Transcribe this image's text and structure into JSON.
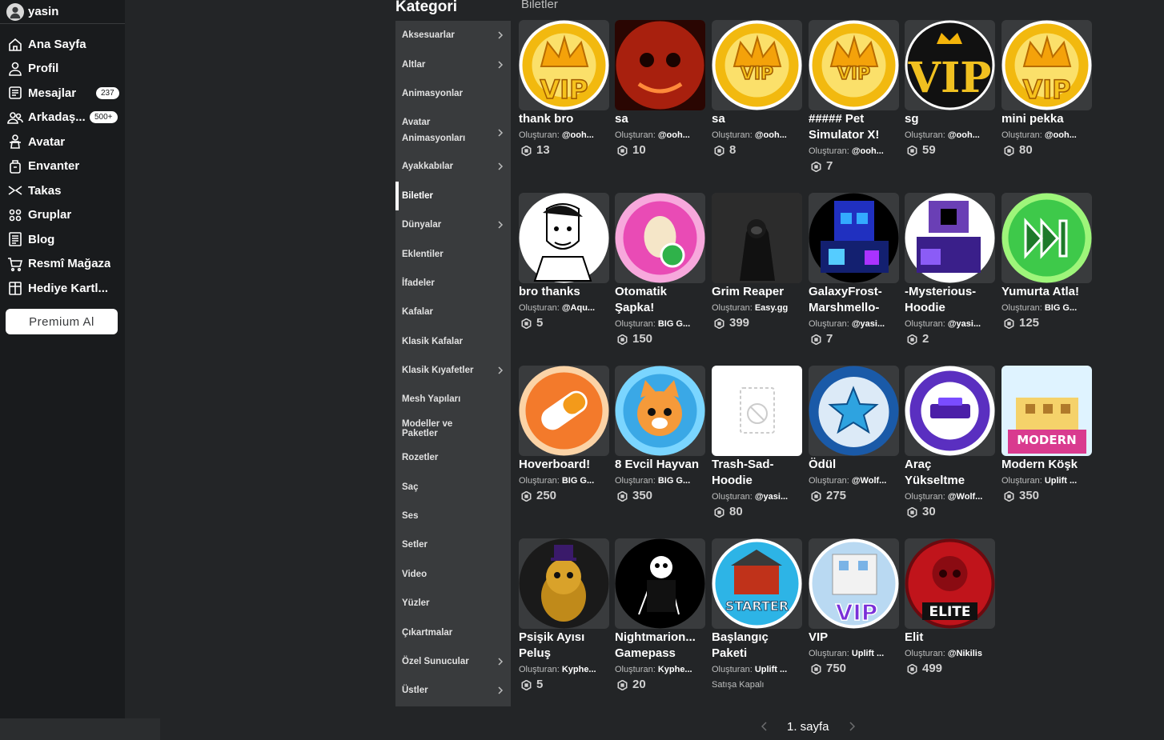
{
  "user": {
    "name": "yasin"
  },
  "nav": {
    "items": [
      {
        "label": "Ana Sayfa",
        "icon": "home-icon"
      },
      {
        "label": "Profil",
        "icon": "profile-icon"
      },
      {
        "label": "Mesajlar",
        "icon": "messages-icon",
        "badge": "237"
      },
      {
        "label": "Arkadaş...",
        "icon": "friends-icon",
        "badge": "500+"
      },
      {
        "label": "Avatar",
        "icon": "avatar-icon"
      },
      {
        "label": "Envanter",
        "icon": "inventory-icon"
      },
      {
        "label": "Takas",
        "icon": "trade-icon"
      },
      {
        "label": "Gruplar",
        "icon": "groups-icon"
      },
      {
        "label": "Blog",
        "icon": "blog-icon"
      },
      {
        "label": "Resmî Mağaza",
        "icon": "shop-icon"
      },
      {
        "label": "Hediye Kartl...",
        "icon": "giftcard-icon"
      }
    ],
    "premium_label": "Premium Al"
  },
  "category": {
    "title": "Kategori",
    "breadcrumb": "Biletler",
    "items": [
      {
        "label": "Aksesuarlar",
        "chevron": true
      },
      {
        "label": "Altlar",
        "chevron": true
      },
      {
        "label": "Animasyonlar",
        "chevron": false
      },
      {
        "label": "Avatar Animasyonları",
        "chevron": true,
        "tall": true
      },
      {
        "label": "Ayakkabılar",
        "chevron": true
      },
      {
        "label": "Biletler",
        "chevron": false,
        "active": true
      },
      {
        "label": "Dünyalar",
        "chevron": true
      },
      {
        "label": "Eklentiler",
        "chevron": false
      },
      {
        "label": "İfadeler",
        "chevron": false
      },
      {
        "label": "Kafalar",
        "chevron": false
      },
      {
        "label": "Klasik Kafalar",
        "chevron": false
      },
      {
        "label": "Klasik Kıyafetler",
        "chevron": true
      },
      {
        "label": "Mesh Yapıları",
        "chevron": false
      },
      {
        "label": "Modeller ve Paketler",
        "chevron": false
      },
      {
        "label": "Rozetler",
        "chevron": false
      },
      {
        "label": "Saç",
        "chevron": false
      },
      {
        "label": "Ses",
        "chevron": false
      },
      {
        "label": "Setler",
        "chevron": false
      },
      {
        "label": "Video",
        "chevron": false
      },
      {
        "label": "Yüzler",
        "chevron": false
      },
      {
        "label": "Çıkartmalar",
        "chevron": false
      },
      {
        "label": "Özel Sunucular",
        "chevron": true
      },
      {
        "label": "Üstler",
        "chevron": true
      }
    ]
  },
  "creator_prefix": "Oluşturan:",
  "items": [
    {
      "name": "thank bro",
      "creator": "@ooh...",
      "price": "13",
      "thumb": "vip-crown",
      "color": "#f2b90f"
    },
    {
      "name": "sa",
      "creator": "@ooh...",
      "price": "10",
      "thumb": "red-monster",
      "color": "#a8200e"
    },
    {
      "name": "sa",
      "creator": "@ooh...",
      "price": "8",
      "thumb": "vip-crown-small",
      "color": "#f2b90f"
    },
    {
      "name": "##### Pet Simulator X!",
      "creator": "@ooh...",
      "price": "7",
      "thumb": "vip-crown-small",
      "color": "#f2b90f"
    },
    {
      "name": "sg",
      "creator": "@ooh...",
      "price": "59",
      "thumb": "vip-black",
      "color": "#111111"
    },
    {
      "name": "mini pekka",
      "creator": "@ooh...",
      "price": "80",
      "thumb": "vip-crown",
      "color": "#f2b90f"
    },
    {
      "name": "bro thanks",
      "creator": "@Aqu...",
      "price": "5",
      "thumb": "meme-face",
      "color": "#ffffff"
    },
    {
      "name": "Otomatik Şapka!",
      "creator": "BIG G...",
      "price": "150",
      "thumb": "egg",
      "color": "#e94bb5"
    },
    {
      "name": "Grim Reaper",
      "creator": "Easy.gg",
      "price": "399",
      "thumb": "reaper",
      "color": "#2c2c2c"
    },
    {
      "name": "GalaxyFrost-Marshmello-",
      "creator": "@yasi...",
      "price": "7",
      "thumb": "galaxy",
      "color": "#1a2a8a"
    },
    {
      "name": "-Mysterious-Hoodie",
      "creator": "@yasi...",
      "price": "2",
      "thumb": "hoodie-purple",
      "color": "#6a3fb5"
    },
    {
      "name": "Yumurta Atla!",
      "creator": "BIG G...",
      "price": "125",
      "thumb": "skip",
      "color": "#3ec94a"
    },
    {
      "name": "Hoverboard!",
      "creator": "BIG G...",
      "price": "250",
      "thumb": "hoverboard",
      "color": "#f37a2b"
    },
    {
      "name": "8 Evcil Hayvan",
      "creator": "BIG G...",
      "price": "350",
      "thumb": "pet",
      "color": "#3aa8e6"
    },
    {
      "name": "Trash-Sad-Hoodie",
      "creator": "@yasi...",
      "price": "80",
      "thumb": "blank",
      "color": "#ffffff"
    },
    {
      "name": "Ödül",
      "creator": "@Wolf...",
      "price": "275",
      "thumb": "premium-star",
      "color": "#2ea3e0"
    },
    {
      "name": "Araç Yükseltme",
      "creator": "@Wolf...",
      "price": "30",
      "thumb": "vehicle",
      "color": "#5a2fc0"
    },
    {
      "name": "Modern Köşk",
      "creator": "Uplift ...",
      "price": "350",
      "thumb": "mansion",
      "color": "#7ec8e8"
    },
    {
      "name": "Psişik Ayısı Peluş",
      "creator": "Kyphe...",
      "price": "5",
      "thumb": "bear",
      "color": "#1a1a1a"
    },
    {
      "name": "Nightmarion... Gamepass",
      "creator": "Kyphe...",
      "price": "20",
      "thumb": "puppet",
      "color": "#000000"
    },
    {
      "name": "Başlangıç Paketi",
      "creator": "Uplift ...",
      "price": "",
      "offsale": "Satışa Kapalı",
      "thumb": "starter",
      "color": "#2db4e6"
    },
    {
      "name": "VIP",
      "creator": "Uplift ...",
      "price": "750",
      "thumb": "vip-house",
      "color": "#b9d9f2"
    },
    {
      "name": "Elit",
      "creator": "@Nikilis",
      "price": "499",
      "thumb": "elite",
      "color": "#c0141b"
    }
  ],
  "pager": {
    "label": "1. sayfa"
  }
}
